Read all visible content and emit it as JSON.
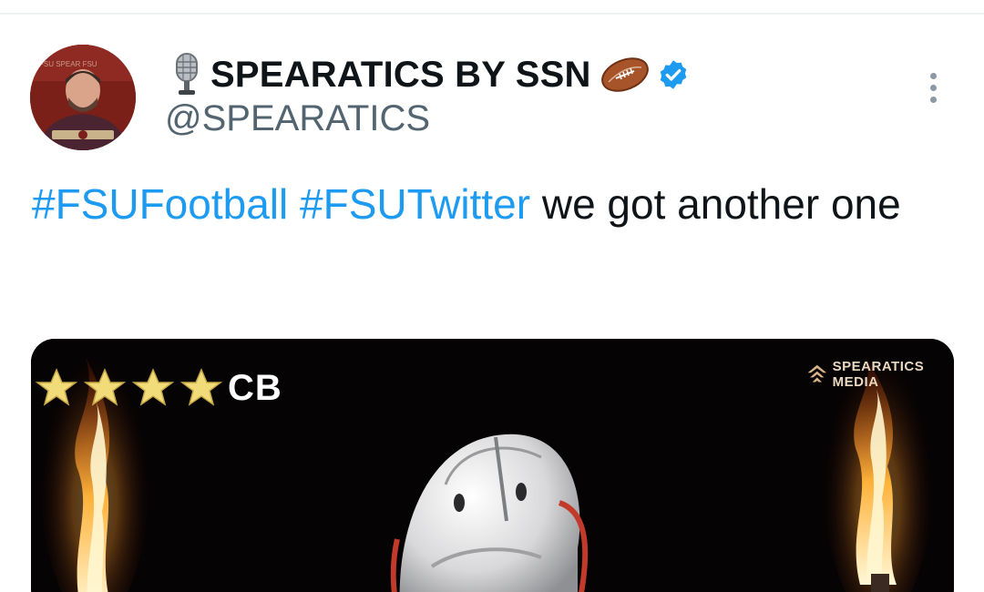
{
  "tweet": {
    "author": {
      "display_name": "SPEARATICS BY SSN",
      "handle": "@SPEARATICS",
      "avatar_icon": "profile-photo",
      "prefix_icon": "microphone-icon",
      "suffix_icon": "american-football-icon",
      "verified": true,
      "verified_color": "#1d9bf0"
    },
    "text_segments": [
      {
        "text": "#FSUFootball",
        "type": "hashtag"
      },
      {
        "text": " ",
        "type": "plain"
      },
      {
        "text": "#FSUTwitter",
        "type": "hashtag"
      },
      {
        "text": " we got another one",
        "type": "plain"
      }
    ],
    "media": {
      "position_label": "CB",
      "star_rating": 4,
      "star_color": "#f2dc7a",
      "watermark": "SPEARATICS MEDIA",
      "flames_color": "#ff8a1e"
    }
  },
  "colors": {
    "text": "#0f1419",
    "secondary_text": "#536471",
    "link": "#1d9bf0",
    "divider": "#eff3f4"
  }
}
